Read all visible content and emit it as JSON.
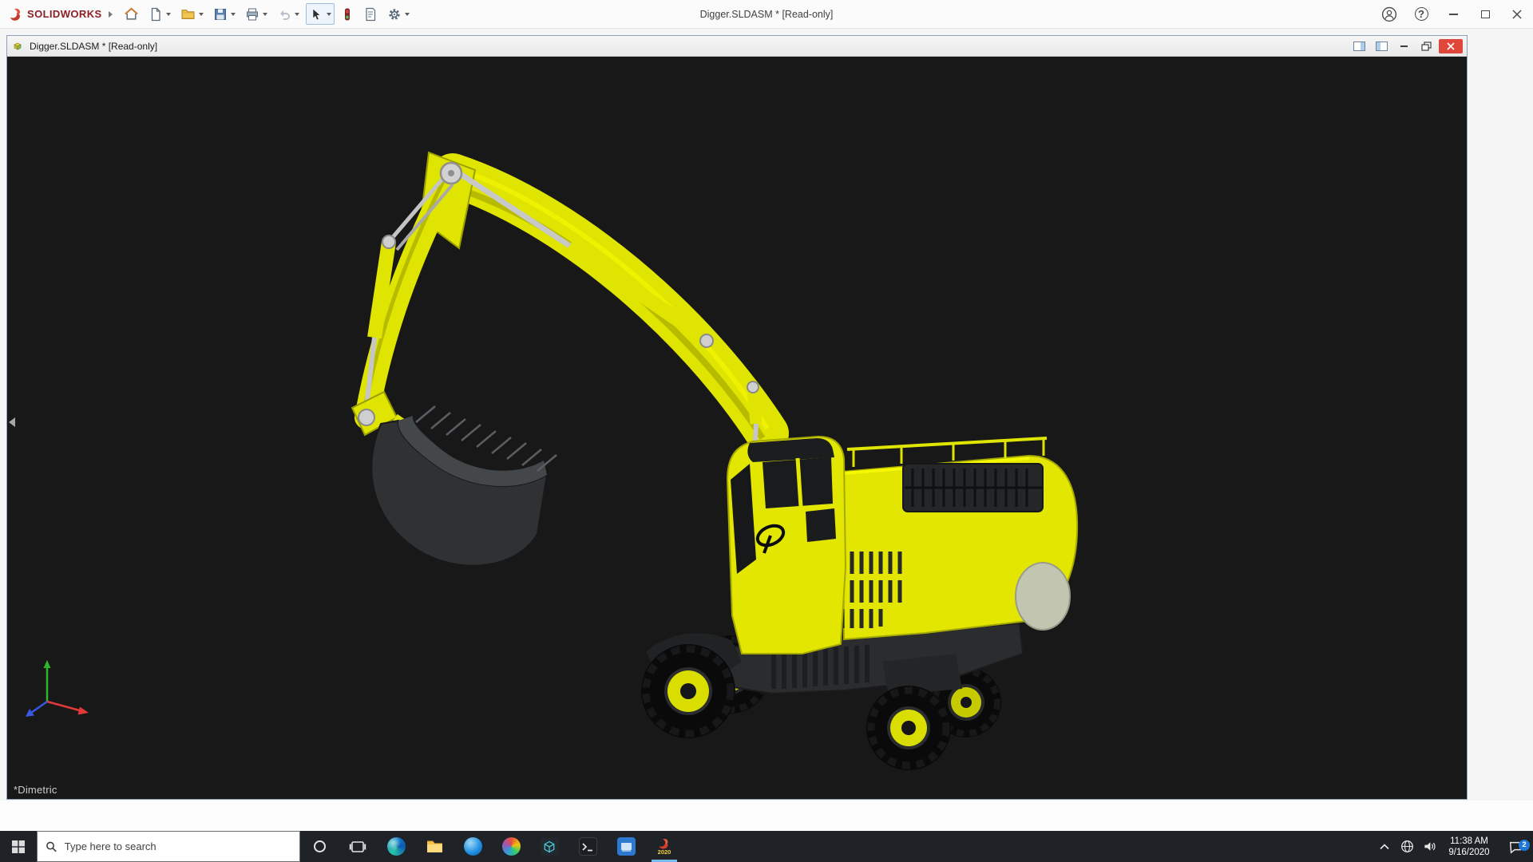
{
  "app": {
    "brand": "SOLIDWORKS",
    "title": "Digger.SLDASM * [Read-only]",
    "help_label": "?",
    "toolbar_icons": [
      "home",
      "new-document",
      "open",
      "save",
      "print",
      "undo",
      "select",
      "rebuild",
      "file-properties",
      "options"
    ]
  },
  "document_window": {
    "title": "Digger.SLDASM * [Read-only]"
  },
  "viewport": {
    "view_orientation": "*Dimetric",
    "background_color": "#181818",
    "model": {
      "name": "Digger",
      "primary_color": "#dfe400",
      "metal_color": "#c8c8c8",
      "dark_color": "#2a2c2e"
    },
    "triad_axes": [
      {
        "axis": "Y",
        "color": "#2db52d",
        "direction": "up"
      },
      {
        "axis": "X",
        "color": "#e03a3a",
        "direction": "lower-right"
      },
      {
        "axis": "Z",
        "color": "#3a57e0",
        "direction": "lower-left"
      }
    ]
  },
  "taskbar": {
    "search_placeholder": "Type here to search",
    "solidworks_year": "2020",
    "icons": [
      "start",
      "search",
      "cortana",
      "task-view",
      "edge",
      "file-explorer",
      "skype",
      "photos",
      "edrawings",
      "command-prompt",
      "display-app",
      "solidworks-2020"
    ],
    "tray": {
      "time": "11:38 AM",
      "date": "9/16/2020",
      "notification_count": "2"
    }
  }
}
